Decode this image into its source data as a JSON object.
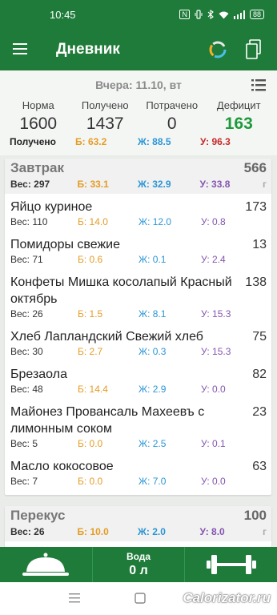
{
  "status": {
    "time": "10:45",
    "nfc": "N",
    "battery": "88"
  },
  "appbar": {
    "title": "Дневник"
  },
  "summary": {
    "date": "Вчера: 11.10, вт",
    "norm_label": "Норма",
    "norm": "1600",
    "got_label": "Получено",
    "got": "1437",
    "spent_label": "Потрачено",
    "spent": "0",
    "deficit_label": "Дефицит",
    "deficit": "163",
    "macros_label": "Получено",
    "b": "Б: 63.2",
    "zh": "Ж: 88.5",
    "u": "У: 96.3"
  },
  "breakfast": {
    "name": "Завтрак",
    "kcal": "566",
    "weight": "Вес: 297",
    "b": "Б: 33.1",
    "zh": "Ж: 32.9",
    "u": "У: 33.8",
    "unit": "г",
    "items": [
      {
        "name": "Яйцо куриное",
        "kcal": "173",
        "w": "Вес: 110",
        "b": "Б: 14.0",
        "zh": "Ж: 12.0",
        "u": "У: 0.8"
      },
      {
        "name": "Помидоры свежие",
        "kcal": "13",
        "w": "Вес: 71",
        "b": "Б: 0.6",
        "zh": "Ж: 0.1",
        "u": "У: 2.4"
      },
      {
        "name": "Конфеты Мишка косолапый Красный октябрь",
        "kcal": "138",
        "w": "Вес: 26",
        "b": "Б: 1.5",
        "zh": "Ж: 8.1",
        "u": "У: 15.3"
      },
      {
        "name": "Хлеб Лапландский Свежий хлеб",
        "kcal": "75",
        "w": "Вес: 30",
        "b": "Б: 2.7",
        "zh": "Ж: 0.3",
        "u": "У: 15.3"
      },
      {
        "name": "Брезаола",
        "kcal": "82",
        "w": "Вес: 48",
        "b": "Б: 14.4",
        "zh": "Ж: 2.9",
        "u": "У: 0.0"
      },
      {
        "name": "Майонез Провансаль Махеевъ с лимонным соком",
        "kcal": "23",
        "w": "Вес: 5",
        "b": "Б: 0.0",
        "zh": "Ж: 2.5",
        "u": "У: 0.1"
      },
      {
        "name": "Масло кокосовое",
        "kcal": "63",
        "w": "Вес: 7",
        "b": "Б: 0.0",
        "zh": "Ж: 7.0",
        "u": "У: 0.0"
      }
    ]
  },
  "snack": {
    "name": "Перекус",
    "kcal": "100",
    "weight": "Вес: 26",
    "b": "Б: 10.0",
    "zh": "Ж: 2.0",
    "u": "У: 8.0",
    "unit": "г"
  },
  "bottombar": {
    "water_label": "Вода",
    "water_value": "0 л"
  },
  "watermark": "Calorizator.ru"
}
